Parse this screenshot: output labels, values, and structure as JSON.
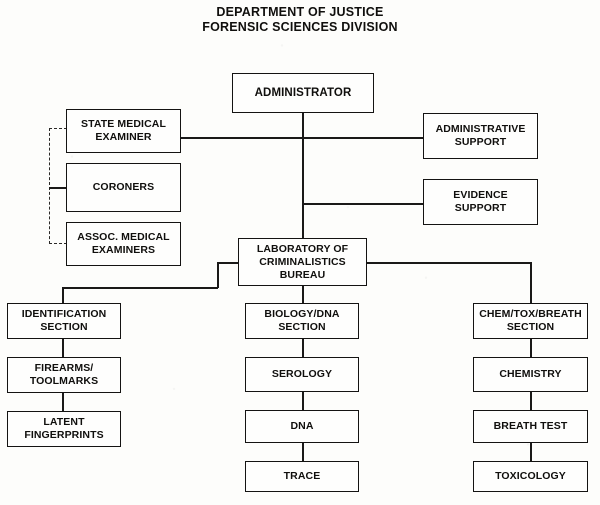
{
  "title": {
    "line1": "DEPARTMENT OF JUSTICE",
    "line2": "FORENSIC SCIENCES DIVISION"
  },
  "colors": {
    "box_border": "#141312",
    "box_fill": "#fefefd",
    "connector": "#1a1918",
    "dashed_connector": "#2a2927",
    "text": "#100f0d",
    "page_background": "#fdfdfb"
  },
  "nodes": {
    "administrator": "ADMINISTRATOR",
    "state_medical_examiner": "STATE MEDICAL\nEXAMINER",
    "coroners": "CORONERS",
    "assoc_medical_examiners": "ASSOC. MEDICAL\nEXAMINERS",
    "administrative_support": "ADMINISTRATIVE\nSUPPORT",
    "evidence_support": "EVIDENCE\nSUPPORT",
    "laboratory_bureau": "LABORATORY OF\nCRIMINALISTICS\nBUREAU",
    "identification_section": "IDENTIFICATION\nSECTION",
    "firearms_toolmarks": "FIREARMS/\nTOOLMARKS",
    "latent_fingerprints": "LATENT\nFINGERPRINTS",
    "biology_dna_section": "BIOLOGY/DNA\nSECTION",
    "serology": "SEROLOGY",
    "dna": "DNA",
    "trace": "TRACE",
    "chem_tox_breath_section": "CHEM/TOX/BREATH\nSECTION",
    "chemistry": "CHEMISTRY",
    "breath_test": "BREATH TEST",
    "toxicology": "TOXICOLOGY"
  },
  "chart_data": {
    "type": "diagram",
    "title": "DEPARTMENT OF JUSTICE FORENSIC SCIENCES DIVISION",
    "orientation": "top-down organizational hierarchy",
    "levels": [
      {
        "level": 0,
        "nodes": [
          "ADMINISTRATOR"
        ]
      },
      {
        "level": 1,
        "nodes": [
          "STATE MEDICAL EXAMINER",
          "CORONERS",
          "ASSOC. MEDICAL EXAMINERS",
          "ADMINISTRATIVE SUPPORT",
          "EVIDENCE SUPPORT",
          "LABORATORY OF CRIMINALISTICS BUREAU"
        ]
      },
      {
        "level": 2,
        "nodes": [
          "IDENTIFICATION SECTION",
          "BIOLOGY/DNA SECTION",
          "CHEM/TOX/BREATH SECTION"
        ]
      },
      {
        "level": 3,
        "nodes": [
          "FIREARMS/TOOLMARKS",
          "LATENT FINGERPRINTS",
          "SEROLOGY",
          "DNA",
          "TRACE",
          "CHEMISTRY",
          "BREATH TEST",
          "TOXICOLOGY"
        ]
      }
    ],
    "edges": [
      {
        "from": "ADMINISTRATOR",
        "to": "STATE MEDICAL EXAMINER",
        "style": "solid"
      },
      {
        "from": "ADMINISTRATOR",
        "to": "ADMINISTRATIVE SUPPORT",
        "style": "solid"
      },
      {
        "from": "ADMINISTRATOR",
        "to": "EVIDENCE SUPPORT",
        "style": "solid"
      },
      {
        "from": "ADMINISTRATOR",
        "to": "LABORATORY OF CRIMINALISTICS BUREAU",
        "style": "solid"
      },
      {
        "from": "STATE MEDICAL EXAMINER",
        "to": "CORONERS",
        "style": "dashed"
      },
      {
        "from": "STATE MEDICAL EXAMINER",
        "to": "ASSOC. MEDICAL EXAMINERS",
        "style": "dashed"
      },
      {
        "from": "LABORATORY OF CRIMINALISTICS BUREAU",
        "to": "IDENTIFICATION SECTION",
        "style": "solid"
      },
      {
        "from": "LABORATORY OF CRIMINALISTICS BUREAU",
        "to": "BIOLOGY/DNA SECTION",
        "style": "solid"
      },
      {
        "from": "LABORATORY OF CRIMINALISTICS BUREAU",
        "to": "CHEM/TOX/BREATH SECTION",
        "style": "solid"
      },
      {
        "from": "IDENTIFICATION SECTION",
        "to": "FIREARMS/TOOLMARKS",
        "style": "solid"
      },
      {
        "from": "FIREARMS/TOOLMARKS",
        "to": "LATENT FINGERPRINTS",
        "style": "solid"
      },
      {
        "from": "BIOLOGY/DNA SECTION",
        "to": "SEROLOGY",
        "style": "solid"
      },
      {
        "from": "SEROLOGY",
        "to": "DNA",
        "style": "solid"
      },
      {
        "from": "DNA",
        "to": "TRACE",
        "style": "solid"
      },
      {
        "from": "CHEM/TOX/BREATH SECTION",
        "to": "CHEMISTRY",
        "style": "solid"
      },
      {
        "from": "CHEMISTRY",
        "to": "BREATH TEST",
        "style": "solid"
      },
      {
        "from": "BREATH TEST",
        "to": "TOXICOLOGY",
        "style": "solid"
      }
    ]
  }
}
